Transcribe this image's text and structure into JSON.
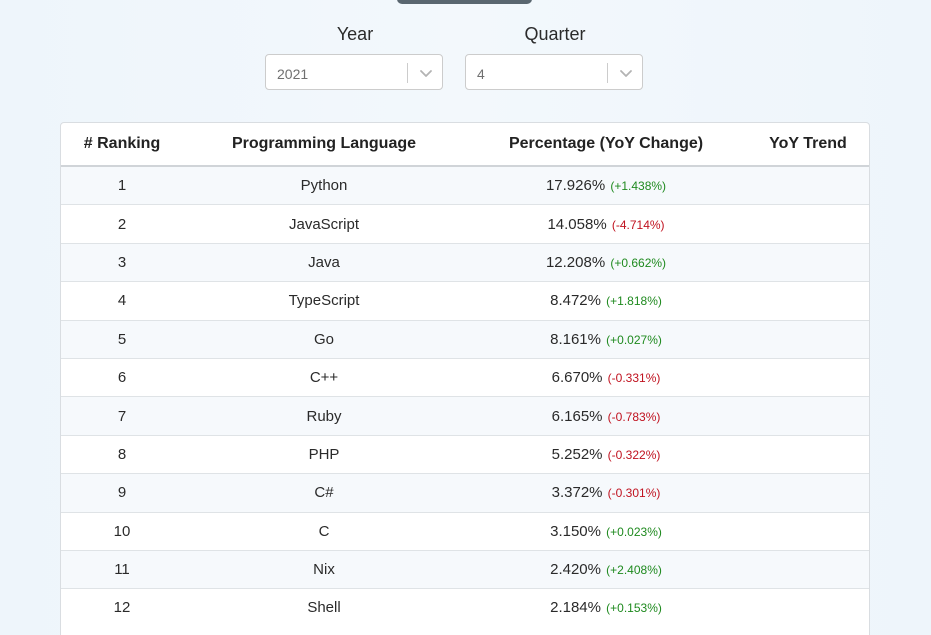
{
  "filters": {
    "year": {
      "label": "Year",
      "value": "2021"
    },
    "quarter": {
      "label": "Quarter",
      "value": "4"
    }
  },
  "table": {
    "headers": [
      "# Ranking",
      "Programming Language",
      "Percentage (YoY Change)",
      "YoY Trend"
    ],
    "rows": [
      {
        "rank": "1",
        "language": "Python",
        "percentage": "17.926%",
        "change": "+1.438%"
      },
      {
        "rank": "2",
        "language": "JavaScript",
        "percentage": "14.058%",
        "change": "-4.714%"
      },
      {
        "rank": "3",
        "language": "Java",
        "percentage": "12.208%",
        "change": "+0.662%"
      },
      {
        "rank": "4",
        "language": "TypeScript",
        "percentage": "8.472%",
        "change": "+1.818%"
      },
      {
        "rank": "5",
        "language": "Go",
        "percentage": "8.161%",
        "change": "+0.027%"
      },
      {
        "rank": "6",
        "language": "C++",
        "percentage": "6.670%",
        "change": "-0.331%"
      },
      {
        "rank": "7",
        "language": "Ruby",
        "percentage": "6.165%",
        "change": "-0.783%"
      },
      {
        "rank": "8",
        "language": "PHP",
        "percentage": "5.252%",
        "change": "-0.322%"
      },
      {
        "rank": "9",
        "language": "C#",
        "percentage": "3.372%",
        "change": "-0.301%"
      },
      {
        "rank": "10",
        "language": "C",
        "percentage": "3.150%",
        "change": "+0.023%"
      },
      {
        "rank": "11",
        "language": "Nix",
        "percentage": "2.420%",
        "change": "+2.408%"
      },
      {
        "rank": "12",
        "language": "Shell",
        "percentage": "2.184%",
        "change": "+0.153%"
      }
    ]
  },
  "colors": {
    "positive": "#1f8a1f",
    "negative": "#c0121f",
    "top_button": "#5a6770"
  }
}
